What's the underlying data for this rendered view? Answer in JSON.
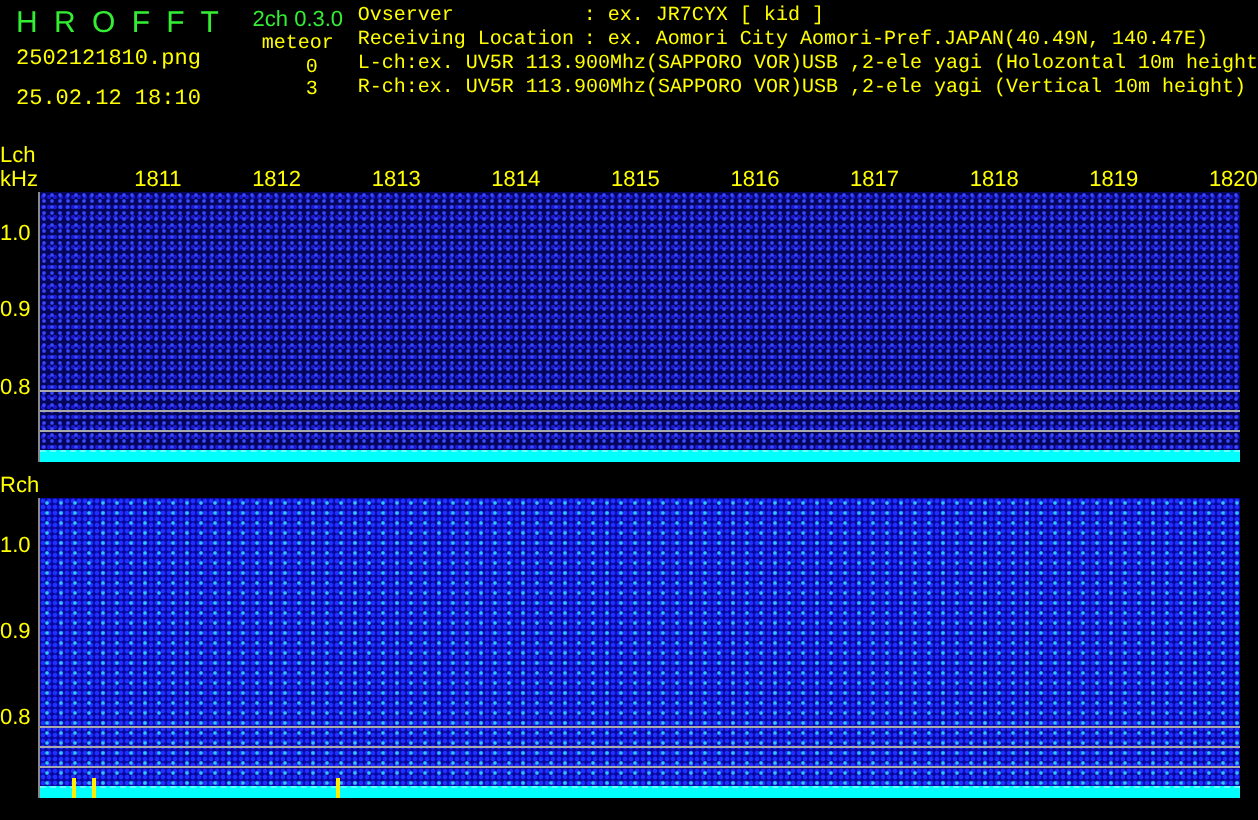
{
  "app": {
    "logo": "H R O F F T",
    "version": "2ch 0.3.0"
  },
  "file_name": "2502121810.png",
  "timestamp": "25.02.12 18:10",
  "meteor": {
    "label": "meteor",
    "counts": [
      "0",
      "3"
    ]
  },
  "info": [
    {
      "label": "Ovserver",
      "value": ": ex. JR7CYX [ kid ]"
    },
    {
      "label": "Receiving Location",
      "value": ": ex. Aomori City Aomori-Pref.JAPAN(40.49N, 140.47E)"
    }
  ],
  "channels_info": [
    "L-ch:ex. UV5R 113.900Mhz(SAPPORO VOR)USB ,2-ele yagi (Holozontal 10m height",
    "R-ch:ex. UV5R 113.900Mhz(SAPPORO VOR)USB ,2-ele yagi (Vertical 10m height)"
  ],
  "time_axis": [
    "1811",
    "1812",
    "1813",
    "1814",
    "1815",
    "1816",
    "1817",
    "1818",
    "1819",
    "1820"
  ],
  "panels": [
    {
      "name": "Lch",
      "unit": "kHz",
      "ticks": [
        "1.0",
        "0.9",
        "0.8"
      ]
    },
    {
      "name": "Rch",
      "ticks": [
        "1.0",
        "0.9",
        "0.8"
      ]
    }
  ]
}
